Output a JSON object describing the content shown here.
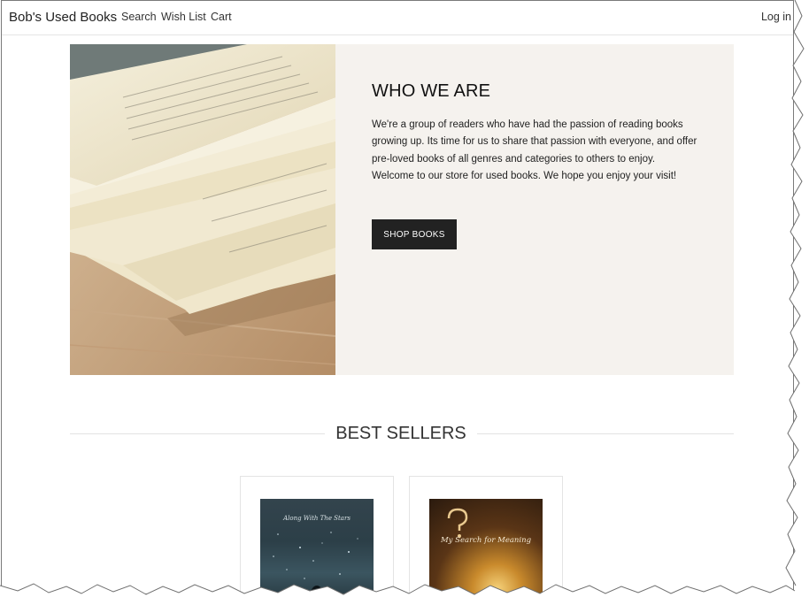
{
  "navbar": {
    "brand": "Bob's Used Books",
    "links": [
      "Search",
      "Wish List",
      "Cart"
    ],
    "login": "Log in"
  },
  "hero": {
    "title": "WHO WE ARE",
    "text": "We're a group of readers who have had the passion of reading books growing up. Its time for us to share that passion with everyone, and offer pre-loved books of all genres and categories to others to enjoy. Welcome to our store for used books. We hope you enjoy your visit!",
    "button": "SHOP BOOKS"
  },
  "best_sellers": {
    "title": "BEST SELLERS",
    "books": [
      {
        "cover_title": "Along With The Stars"
      },
      {
        "cover_title": "My Search for Meaning"
      }
    ]
  },
  "colors": {
    "button_bg": "#222222",
    "hero_panel_bg": "#f5f2ee"
  }
}
